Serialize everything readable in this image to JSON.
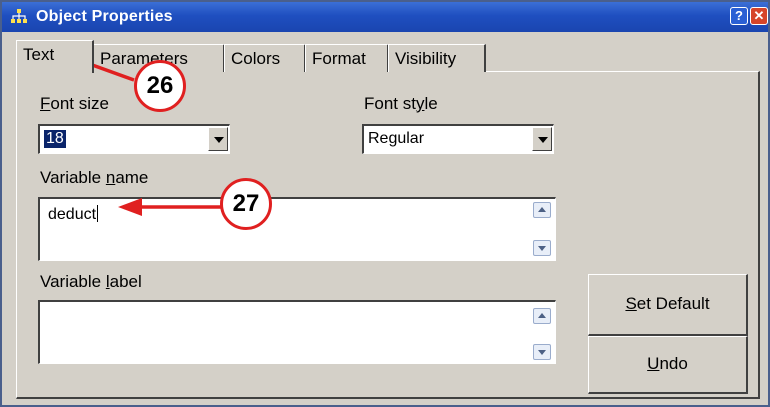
{
  "window": {
    "title": "Object Properties",
    "help_glyph": "?",
    "close_glyph": "✕"
  },
  "tabs": [
    {
      "label": "Text"
    },
    {
      "label": "Parameters"
    },
    {
      "label": "Colors"
    },
    {
      "label": "Format"
    },
    {
      "label": "Visibility"
    }
  ],
  "font_size": {
    "label_first": "F",
    "label_rest": "ont size",
    "value": "18"
  },
  "font_style": {
    "label_pre": "Font st",
    "label_u": "y",
    "label_post": "le",
    "value": "Regular"
  },
  "variable_name": {
    "label_pre": "Variable ",
    "label_u": "n",
    "label_post": "ame",
    "value": "deduct"
  },
  "variable_label": {
    "label_pre": "Variable ",
    "label_u": "l",
    "label_post": "abel",
    "value": ""
  },
  "buttons": {
    "set_default": {
      "u": "S",
      "rest": "et Default"
    },
    "undo": {
      "u": "U",
      "rest": "ndo"
    }
  },
  "callouts": {
    "tab": "26",
    "name": "27"
  },
  "colors": {
    "callout_red": "#e02020",
    "title_blue": "#1f4fc0"
  }
}
